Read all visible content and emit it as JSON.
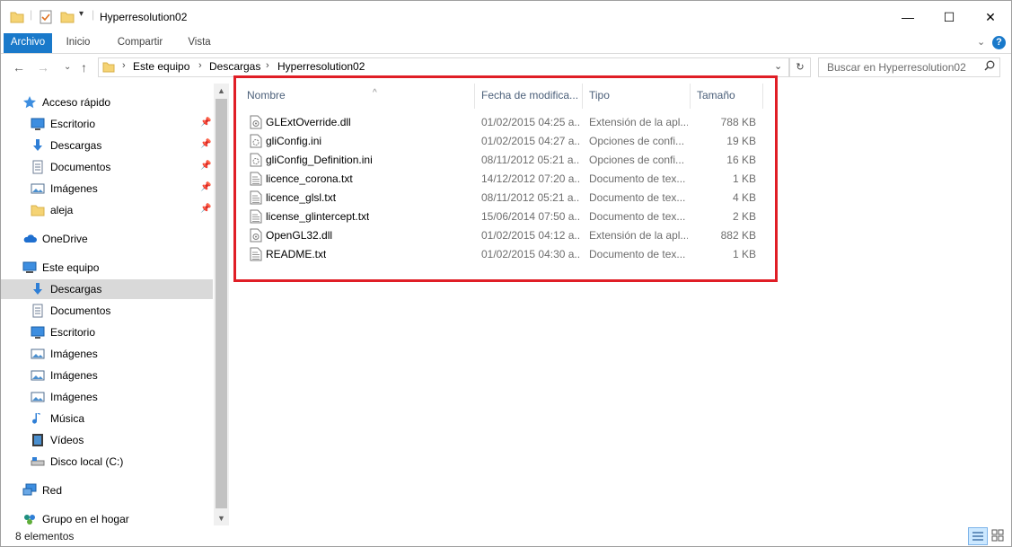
{
  "window": {
    "title": "Hyperresolution02",
    "controls": {
      "minimize": "—",
      "maximize": "☐",
      "close": "✕"
    }
  },
  "ribbon": {
    "tabs": [
      "Archivo",
      "Inicio",
      "Compartir",
      "Vista"
    ],
    "collapse_glyph": "⌄",
    "help_glyph": "?"
  },
  "address": {
    "crumbs": [
      "Este equipo",
      "Descargas",
      "Hyperresolution02"
    ],
    "separator": "›",
    "dropdown_glyph": "⌄",
    "refresh_glyph": "↻"
  },
  "search": {
    "placeholder": "Buscar en Hyperresolution02",
    "icon": "search-icon"
  },
  "nav": {
    "back": "←",
    "forward": "→",
    "recent": "⌄",
    "up": "↑",
    "items": [
      {
        "label": "Acceso rápido",
        "icon": "star-icon",
        "indent": 0,
        "pinned": false,
        "selected": false
      },
      {
        "label": "Escritorio",
        "icon": "desktop-icon",
        "indent": 1,
        "pinned": true,
        "selected": false
      },
      {
        "label": "Descargas",
        "icon": "download-icon",
        "indent": 1,
        "pinned": true,
        "selected": false
      },
      {
        "label": "Documentos",
        "icon": "document-icon",
        "indent": 1,
        "pinned": true,
        "selected": false
      },
      {
        "label": "Imágenes",
        "icon": "pictures-icon",
        "indent": 1,
        "pinned": true,
        "selected": false
      },
      {
        "label": "aleja",
        "icon": "folder-icon",
        "indent": 1,
        "pinned": true,
        "selected": false
      },
      {
        "label": "OneDrive",
        "icon": "cloud-icon",
        "indent": 0,
        "pinned": false,
        "selected": false
      },
      {
        "label": "Este equipo",
        "icon": "computer-icon",
        "indent": 0,
        "pinned": false,
        "selected": false
      },
      {
        "label": "Descargas",
        "icon": "download-icon",
        "indent": 1,
        "pinned": false,
        "selected": true
      },
      {
        "label": "Documentos",
        "icon": "document-icon",
        "indent": 1,
        "pinned": false,
        "selected": false
      },
      {
        "label": "Escritorio",
        "icon": "desktop-icon",
        "indent": 1,
        "pinned": false,
        "selected": false
      },
      {
        "label": "Imágenes",
        "icon": "pictures-icon",
        "indent": 1,
        "pinned": false,
        "selected": false
      },
      {
        "label": "Imágenes",
        "icon": "pictures-icon",
        "indent": 1,
        "pinned": false,
        "selected": false
      },
      {
        "label": "Imágenes",
        "icon": "pictures-icon",
        "indent": 1,
        "pinned": false,
        "selected": false
      },
      {
        "label": "Música",
        "icon": "music-icon",
        "indent": 1,
        "pinned": false,
        "selected": false
      },
      {
        "label": "Vídeos",
        "icon": "video-icon",
        "indent": 1,
        "pinned": false,
        "selected": false
      },
      {
        "label": "Disco local (C:)",
        "icon": "drive-icon",
        "indent": 1,
        "pinned": false,
        "selected": false
      },
      {
        "label": "Red",
        "icon": "network-icon",
        "indent": 0,
        "pinned": false,
        "selected": false
      },
      {
        "label": "Grupo en el hogar",
        "icon": "homegroup-icon",
        "indent": 0,
        "pinned": false,
        "selected": false
      }
    ]
  },
  "columns": {
    "name": "Nombre",
    "date": "Fecha de modifica...",
    "type": "Tipo",
    "size": "Tamaño",
    "sort_glyph": "^"
  },
  "files": [
    {
      "name": "GLExtOverride.dll",
      "date": "01/02/2015 04:25 a...",
      "type": "Extensión de la apl...",
      "size": "788 KB",
      "icon": "dll-file-icon"
    },
    {
      "name": "gliConfig.ini",
      "date": "01/02/2015 04:27 a...",
      "type": "Opciones de confi...",
      "size": "19 KB",
      "icon": "ini-file-icon"
    },
    {
      "name": "gliConfig_Definition.ini",
      "date": "08/11/2012 05:21 a...",
      "type": "Opciones de confi...",
      "size": "16 KB",
      "icon": "ini-file-icon"
    },
    {
      "name": "licence_corona.txt",
      "date": "14/12/2012 07:20 a...",
      "type": "Documento de tex...",
      "size": "1 KB",
      "icon": "text-file-icon"
    },
    {
      "name": "licence_glsl.txt",
      "date": "08/11/2012 05:21 a...",
      "type": "Documento de tex...",
      "size": "4 KB",
      "icon": "text-file-icon"
    },
    {
      "name": "license_glintercept.txt",
      "date": "15/06/2014 07:50 a...",
      "type": "Documento de tex...",
      "size": "2 KB",
      "icon": "text-file-icon"
    },
    {
      "name": "OpenGL32.dll",
      "date": "01/02/2015 04:12 a...",
      "type": "Extensión de la apl...",
      "size": "882 KB",
      "icon": "dll-file-icon"
    },
    {
      "name": "README.txt",
      "date": "01/02/2015 04:30 a...",
      "type": "Documento de tex...",
      "size": "1 KB",
      "icon": "text-file-icon"
    }
  ],
  "status": {
    "count": "8 elementos"
  },
  "colors": {
    "accent": "#1979ca",
    "highlight": "#e01e26",
    "selection": "#d9d9d9",
    "folder": "#f5d374"
  }
}
